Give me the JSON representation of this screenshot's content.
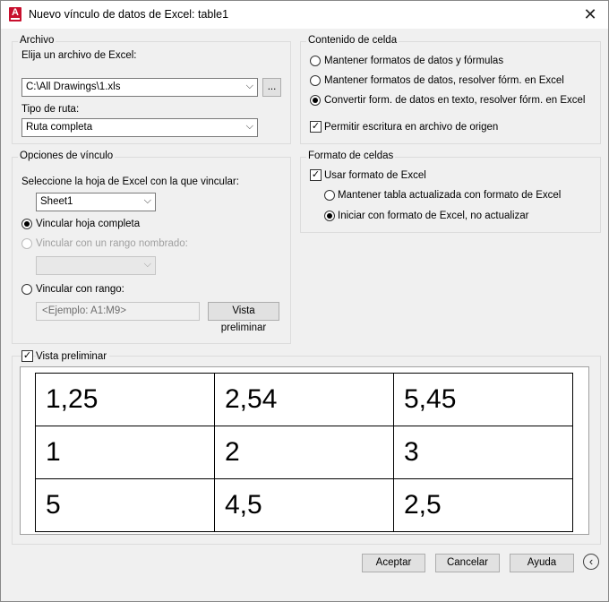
{
  "window": {
    "title": "Nuevo vínculo de datos de Excel: table1",
    "app_icon_letter": "A"
  },
  "archivo": {
    "legend": "Archivo",
    "file_label": "Elija un archivo de Excel:",
    "file_value": "C:\\All Drawings\\1.xls",
    "browse_label": "...",
    "path_label": "Tipo de ruta:",
    "path_value": "Ruta completa"
  },
  "contenido": {
    "legend": "Contenido de celda",
    "options": [
      {
        "label": "Mantener formatos de datos y fórmulas",
        "selected": false
      },
      {
        "label": "Mantener formatos de datos, resolver fórm. en Excel",
        "selected": false
      },
      {
        "label": "Convertir form. de datos en texto, resolver fórm. en Excel",
        "selected": true
      }
    ],
    "write_label": "Permitir escritura en archivo de origen",
    "write_checked": true
  },
  "opciones": {
    "legend": "Opciones de vínculo",
    "sheet_label": "Seleccione la hoja de Excel con la que vincular:",
    "sheet_value": "Sheet1",
    "link_sheet_label": "Vincular hoja completa",
    "named_range_label": "Vincular con un rango nombrado:",
    "range_label": "Vincular con rango:",
    "range_placeholder": "<Ejemplo: A1:M9>",
    "preview_button": "Vista preliminar"
  },
  "formato": {
    "legend": "Formato de celdas",
    "use_excel_label": "Usar formato de Excel",
    "use_excel_checked": true,
    "keep_updated_label": "Mantener tabla actualizada con formato de Excel",
    "start_only_label": "Iniciar con formato de Excel, no actualizar"
  },
  "preview": {
    "label": "Vista preliminar",
    "checked": true,
    "rows": [
      [
        "1,25",
        "2,54",
        "5,45"
      ],
      [
        "1",
        "2",
        "3"
      ],
      [
        "5",
        "4,5",
        "2,5"
      ]
    ]
  },
  "buttons": {
    "ok": "Aceptar",
    "cancel": "Cancelar",
    "help": "Ayuda"
  },
  "icons": {
    "close": "close-icon",
    "back": "chevron-left-icon",
    "dropdown": "chevron-down-icon",
    "check": "checkmark-icon"
  }
}
